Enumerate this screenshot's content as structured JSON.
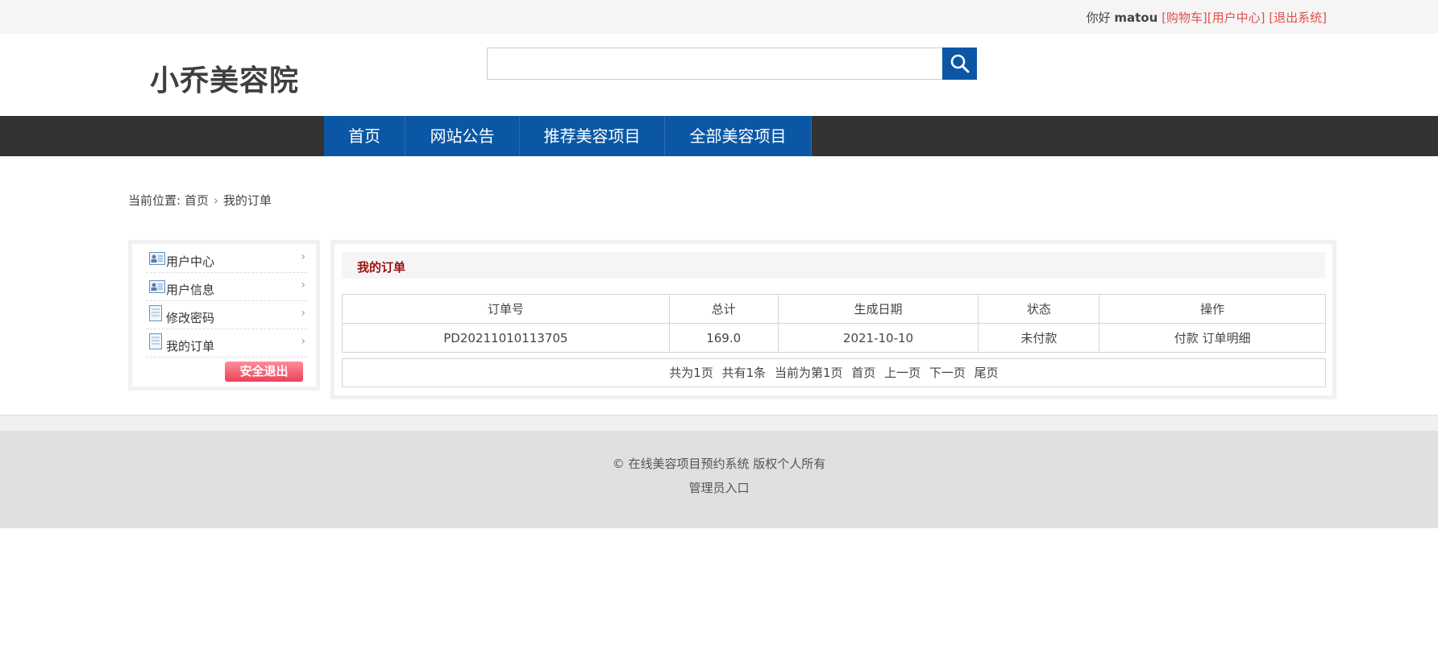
{
  "topbar": {
    "greeting": "你好",
    "username": "matou",
    "cart_link": "[购物车]",
    "center_link": "[用户中心]",
    "logout_link": "[退出系统]"
  },
  "header": {
    "logo": "小乔美容院",
    "search_value": "",
    "search_icon": "search-icon"
  },
  "nav": [
    "首页",
    "网站公告",
    "推荐美容项目",
    "全部美容项目"
  ],
  "breadcrumb": {
    "prefix": "当前位置:",
    "home": "首页",
    "current": "我的订单"
  },
  "sidebar": {
    "items": [
      {
        "label": "用户中心",
        "icon": "user-card-icon"
      },
      {
        "label": "用户信息",
        "icon": "user-card-icon"
      },
      {
        "label": "修改密码",
        "icon": "document-icon"
      },
      {
        "label": "我的订单",
        "icon": "document-icon"
      }
    ],
    "logout": "安全退出"
  },
  "main": {
    "title": "我的订单",
    "columns": [
      "订单号",
      "总计",
      "生成日期",
      "状态",
      "操作"
    ],
    "rows": [
      {
        "order_no": "PD20211010113705",
        "total": "169.0",
        "date": "2021-10-10",
        "status": "未付款",
        "pay": "付款",
        "detail": "订单明细"
      }
    ],
    "pager": {
      "total_pages": "共为1页",
      "total_items": "共有1条",
      "current": "当前为第1页",
      "first": "首页",
      "prev": "上一页",
      "next": "下一页",
      "last": "尾页"
    }
  },
  "footer": {
    "copyright": "© 在线美容项目预约系统 版权个人所有",
    "admin": "管理员入口"
  },
  "colors": {
    "nav_blue": "#0b57a6",
    "nav_bar": "#333333",
    "link_red": "#e0504c",
    "title_red": "#9b1212"
  }
}
